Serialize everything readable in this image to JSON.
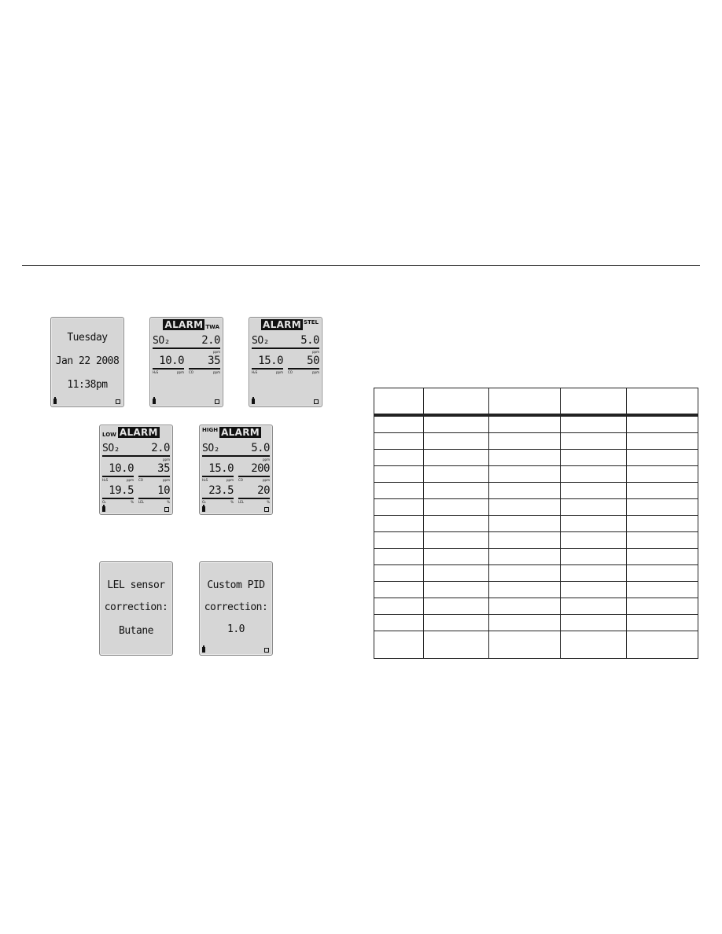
{
  "screens": {
    "datetime": {
      "line1": "Tuesday",
      "line2": "Jan 22 2008",
      "line3": "11:38pm"
    },
    "twa": {
      "banner": "ALARM",
      "suffix": "TWA",
      "main": {
        "gas": "SO₂",
        "value": "2.0",
        "unit": "ppm"
      },
      "sub": [
        {
          "gas": "H₂S",
          "value": "10.0",
          "unit": "ppm"
        },
        {
          "gas": "CO",
          "value": "35",
          "unit": "ppm"
        }
      ]
    },
    "stel": {
      "banner": "ALARM",
      "suffix": "STEL",
      "main": {
        "gas": "SO₂",
        "value": "5.0",
        "unit": "ppm"
      },
      "sub": [
        {
          "gas": "H₂S",
          "value": "15.0",
          "unit": "ppm"
        },
        {
          "gas": "CO",
          "value": "50",
          "unit": "ppm"
        }
      ]
    },
    "low": {
      "prefix": "LOW",
      "banner": "ALARM",
      "main": {
        "gas": "SO₂",
        "value": "2.0",
        "unit": "ppm"
      },
      "sub": [
        {
          "gas": "H₂S",
          "value": "10.0",
          "unit": "ppm"
        },
        {
          "gas": "CO",
          "value": "35",
          "unit": "ppm"
        },
        {
          "gas": "O₂",
          "value": "19.5",
          "unit": "%"
        },
        {
          "gas": "LEL",
          "value": "10",
          "unit": "%"
        }
      ]
    },
    "high": {
      "prefix": "HIGH",
      "banner": "ALARM",
      "main": {
        "gas": "SO₂",
        "value": "5.0",
        "unit": "ppm"
      },
      "sub": [
        {
          "gas": "H₂S",
          "value": "15.0",
          "unit": "ppm"
        },
        {
          "gas": "CO",
          "value": "200",
          "unit": "ppm"
        },
        {
          "gas": "O₂",
          "value": "23.5",
          "unit": "%"
        },
        {
          "gas": "LEL",
          "value": "20",
          "unit": "%"
        }
      ]
    },
    "lel_correction": {
      "line1": "LEL sensor",
      "line2": "correction:",
      "line3": "Butane"
    },
    "pid_correction": {
      "line1": "Custom PID",
      "line2": "correction:",
      "line3": "1.0"
    }
  },
  "table": {
    "columns": 5,
    "header": [
      "",
      "",
      "",
      "",
      ""
    ],
    "rows": [
      [
        "",
        "",
        "",
        "",
        ""
      ],
      [
        "",
        "",
        "",
        "",
        ""
      ],
      [
        "",
        "",
        "",
        "",
        ""
      ],
      [
        "",
        "",
        "",
        "",
        ""
      ],
      [
        "",
        "",
        "",
        "",
        ""
      ],
      [
        "",
        "",
        "",
        "",
        ""
      ],
      [
        "",
        "",
        "",
        "",
        ""
      ],
      [
        "",
        "",
        "",
        "",
        ""
      ],
      [
        "",
        "",
        "",
        "",
        ""
      ],
      [
        "",
        "",
        "",
        "",
        ""
      ],
      [
        "",
        "",
        "",
        "",
        ""
      ],
      [
        "",
        "",
        "",
        "",
        ""
      ],
      [
        "",
        "",
        "",
        "",
        ""
      ],
      [
        "",
        "",
        "",
        "",
        ""
      ]
    ]
  }
}
